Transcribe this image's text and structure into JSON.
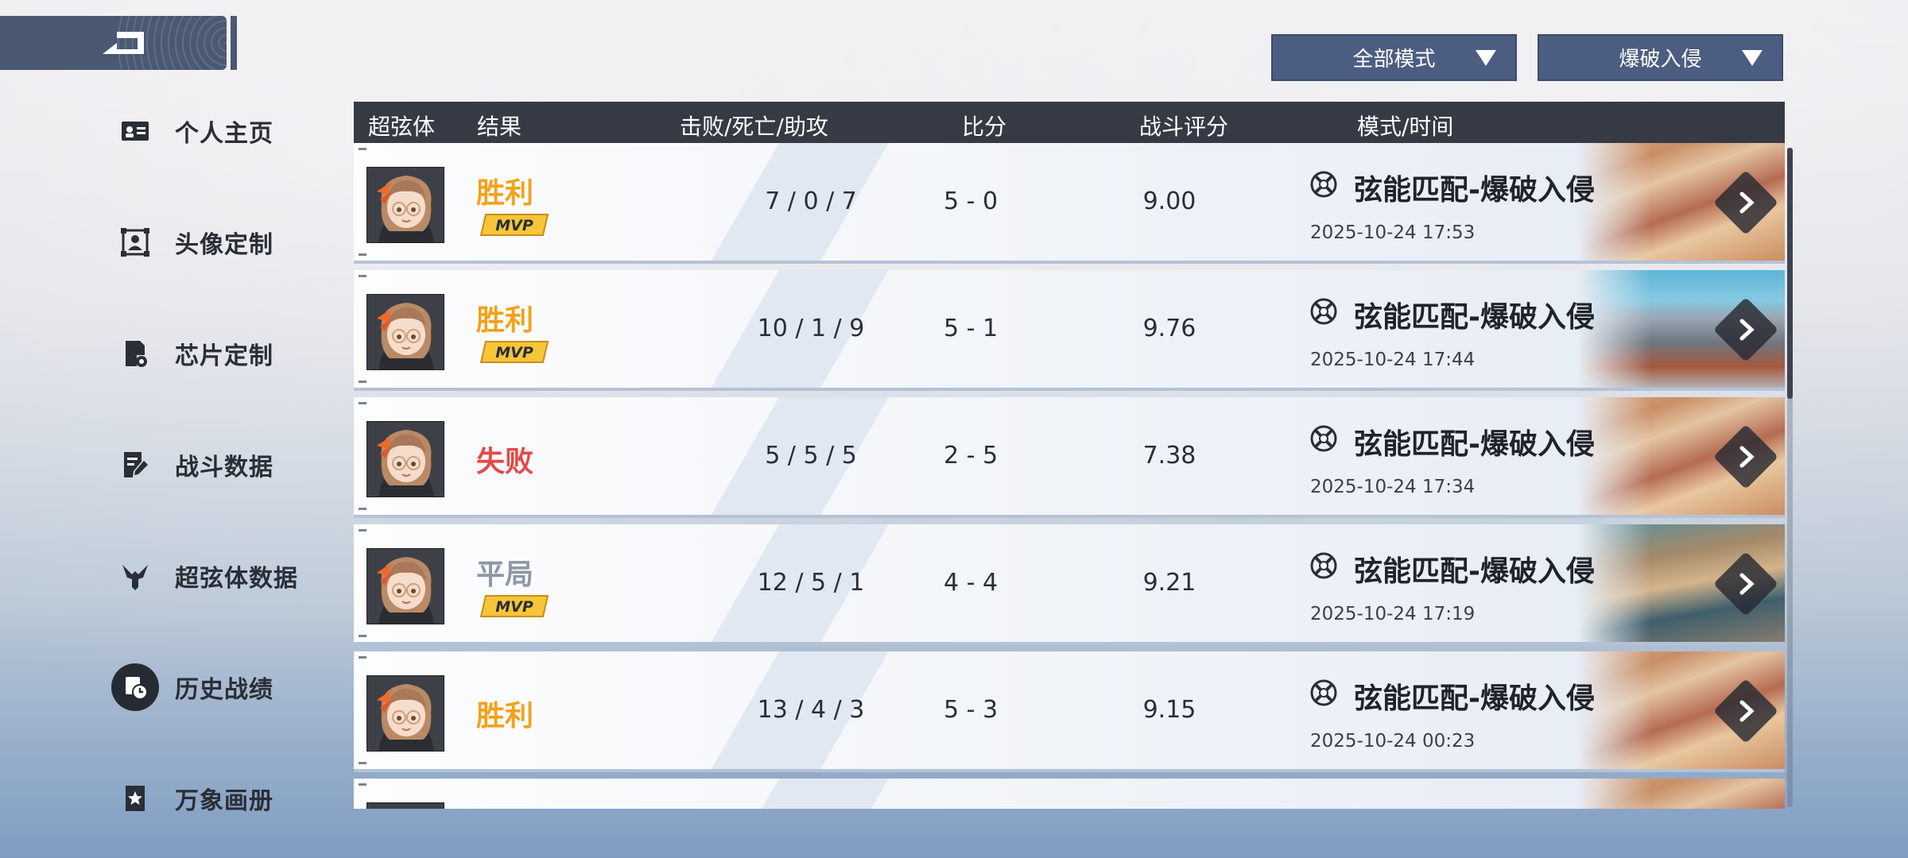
{
  "colors": {
    "win": "#f2a21a",
    "loss": "#e34a45",
    "draw": "#8e97a5",
    "header_bg": "#363a44",
    "filter_bg": "#4b5d80"
  },
  "sidebar": {
    "items": [
      {
        "label": "个人主页",
        "icon": "profile-card-icon",
        "active": false
      },
      {
        "label": "头像定制",
        "icon": "avatar-frame-icon",
        "active": false
      },
      {
        "label": "芯片定制",
        "icon": "chip-gear-icon",
        "active": false
      },
      {
        "label": "战斗数据",
        "icon": "edit-document-icon",
        "active": false
      },
      {
        "label": "超弦体数据",
        "icon": "badge-icon",
        "active": false
      },
      {
        "label": "历史战绩",
        "icon": "history-clock-icon",
        "active": true
      },
      {
        "label": "万象画册",
        "icon": "star-album-icon",
        "active": false
      }
    ]
  },
  "filters": {
    "mode_all": "全部模式",
    "mode_specific": "爆破入侵"
  },
  "table": {
    "headers": {
      "character": "超弦体",
      "result": "结果",
      "kda": "击败/死亡/助攻",
      "score": "比分",
      "rating": "战斗评分",
      "mode_time": "模式/时间"
    },
    "rows": [
      {
        "result": "胜利",
        "result_type": "win",
        "mvp": "MVP",
        "kda": "7 / 0 / 7",
        "score": "5 - 0",
        "rating": "9.00",
        "mode": "弦能匹配-爆破入侵",
        "time": "2025-10-24 17:53",
        "map": "map-a"
      },
      {
        "result": "胜利",
        "result_type": "win",
        "mvp": "MVP",
        "kda": "10 / 1 / 9",
        "score": "5 - 1",
        "rating": "9.76",
        "mode": "弦能匹配-爆破入侵",
        "time": "2025-10-24 17:44",
        "map": "map-b"
      },
      {
        "result": "失败",
        "result_type": "loss",
        "mvp": "",
        "kda": "5 / 5 / 5",
        "score": "2 - 5",
        "rating": "7.38",
        "mode": "弦能匹配-爆破入侵",
        "time": "2025-10-24 17:34",
        "map": "map-a"
      },
      {
        "result": "平局",
        "result_type": "draw",
        "mvp": "MVP",
        "kda": "12 / 5 / 1",
        "score": "4 - 4",
        "rating": "9.21",
        "mode": "弦能匹配-爆破入侵",
        "time": "2025-10-24 17:19",
        "map": "map-c"
      },
      {
        "result": "胜利",
        "result_type": "win",
        "mvp": "",
        "kda": "13 / 4 / 3",
        "score": "5 - 3",
        "rating": "9.15",
        "mode": "弦能匹配-爆破入侵",
        "time": "2025-10-24 00:23",
        "map": "map-a"
      },
      {
        "result": "",
        "result_type": "win",
        "mvp": "",
        "kda": "",
        "score": "",
        "rating": "",
        "mode": "",
        "time": "",
        "map": "map-a"
      }
    ]
  }
}
